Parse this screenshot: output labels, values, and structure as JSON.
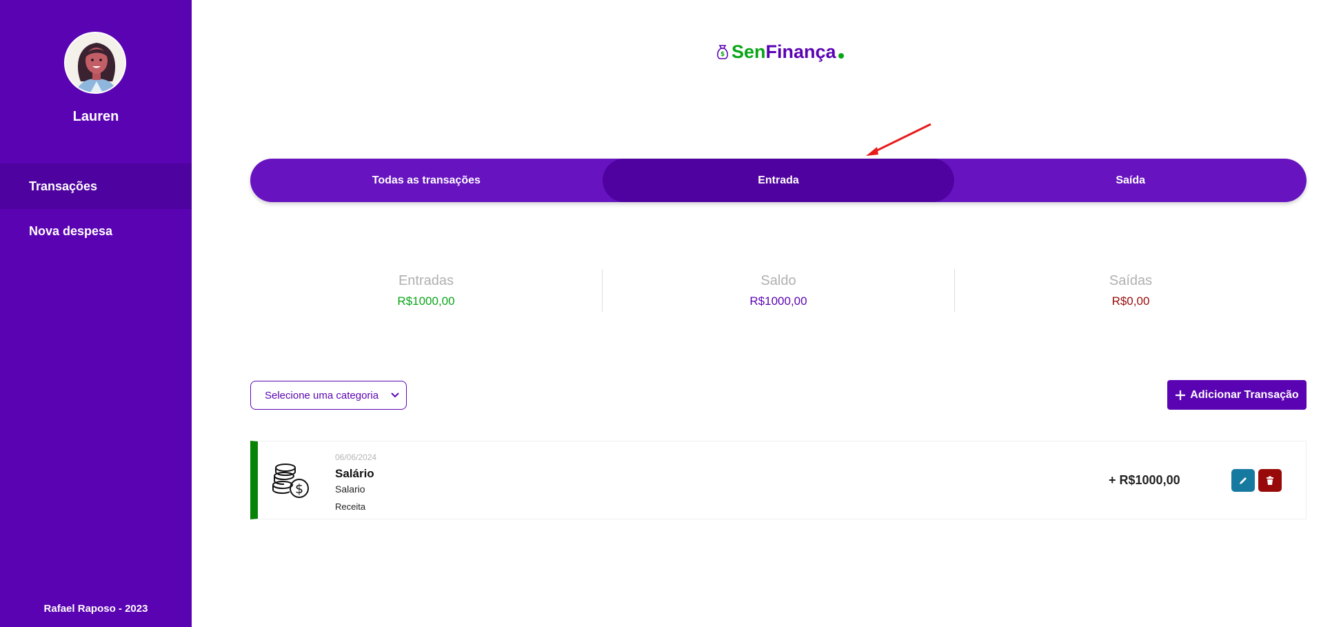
{
  "app": {
    "brand_part1": "Sen",
    "brand_part2": "Finança"
  },
  "sidebar": {
    "username": "Lauren",
    "items": [
      {
        "label": "Transações",
        "active": true
      },
      {
        "label": "Nova despesa",
        "active": false
      }
    ],
    "footer": "Rafael Raposo - 2023"
  },
  "tabs": [
    {
      "label": "Todas as transações",
      "active": false
    },
    {
      "label": "Entrada",
      "active": true
    },
    {
      "label": "Saída",
      "active": false
    }
  ],
  "summary": {
    "entradas_label": "Entradas",
    "entradas_value": "R$1000,00",
    "saldo_label": "Saldo",
    "saldo_value": "R$1000,00",
    "saidas_label": "Saídas",
    "saidas_value": "R$0,00"
  },
  "filters": {
    "category_placeholder": "Selecione uma categoria"
  },
  "actions": {
    "add_label": "Adicionar Transação"
  },
  "transactions": [
    {
      "date": "06/06/2024",
      "title": "Salário",
      "description": "Salario",
      "type": "Receita",
      "amount": "+ R$1000,00"
    }
  ],
  "colors": {
    "primary": "#5a03b3",
    "income": "#0aa517",
    "balance": "#5a03b3",
    "expense": "#980a0a",
    "edit": "#167aa0",
    "delete": "#980a0a",
    "tx_stripe": "#068305"
  }
}
